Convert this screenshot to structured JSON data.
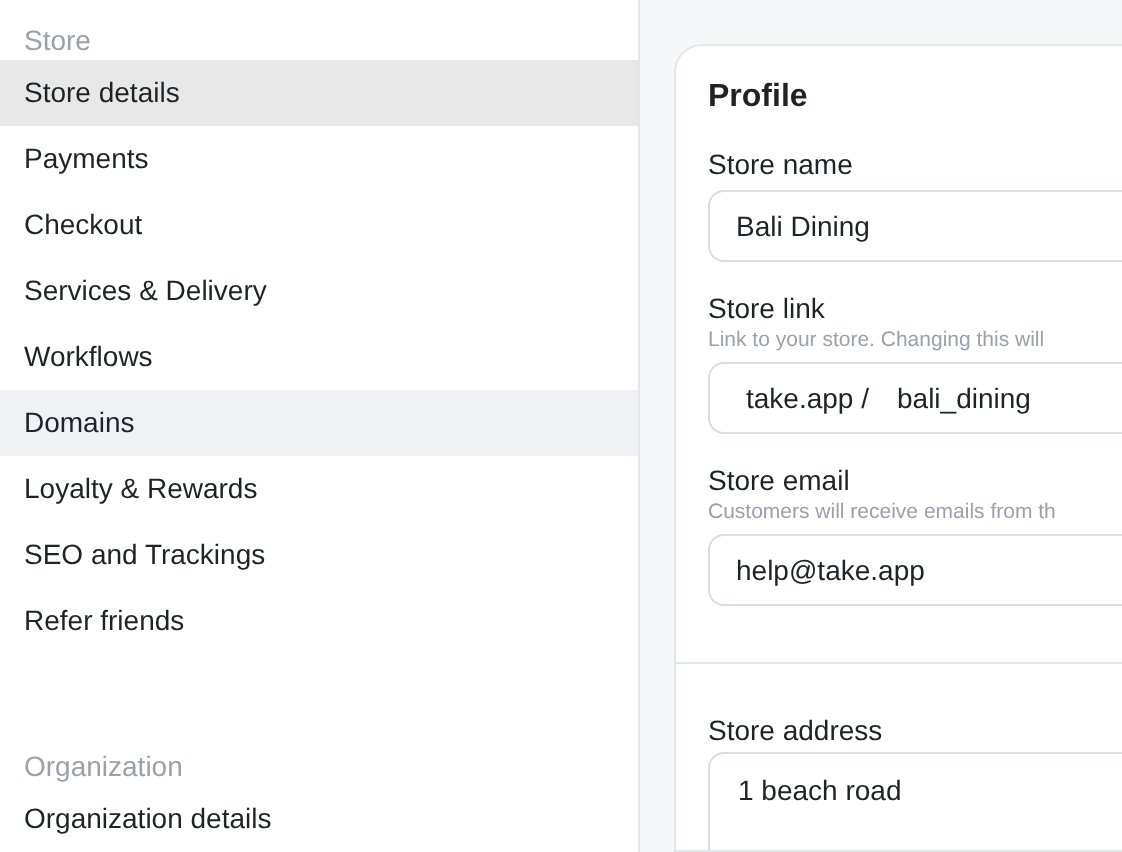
{
  "sidebar": {
    "sections": [
      {
        "title": "Store",
        "items": [
          {
            "label": "Store details",
            "selected": true,
            "hovered": false
          },
          {
            "label": "Payments",
            "selected": false,
            "hovered": false
          },
          {
            "label": "Checkout",
            "selected": false,
            "hovered": false
          },
          {
            "label": "Services & Delivery",
            "selected": false,
            "hovered": false
          },
          {
            "label": "Workflows",
            "selected": false,
            "hovered": false
          },
          {
            "label": "Domains",
            "selected": false,
            "hovered": true
          },
          {
            "label": "Loyalty & Rewards",
            "selected": false,
            "hovered": false
          },
          {
            "label": "SEO and Trackings",
            "selected": false,
            "hovered": false
          },
          {
            "label": "Refer friends",
            "selected": false,
            "hovered": false
          }
        ]
      },
      {
        "title": "Organization",
        "items": [
          {
            "label": "Organization details",
            "selected": false,
            "hovered": false
          }
        ]
      }
    ]
  },
  "profile": {
    "title": "Profile",
    "store_name": {
      "label": "Store name",
      "value": "Bali Dining"
    },
    "store_link": {
      "label": "Store link",
      "hint": "Link to your store. Changing this will",
      "prefix": "take.app /",
      "value": "bali_dining"
    },
    "store_email": {
      "label": "Store email",
      "hint": "Customers will receive emails from th",
      "value": "help@take.app"
    },
    "store_address": {
      "label": "Store address",
      "value": "1 beach road"
    }
  }
}
